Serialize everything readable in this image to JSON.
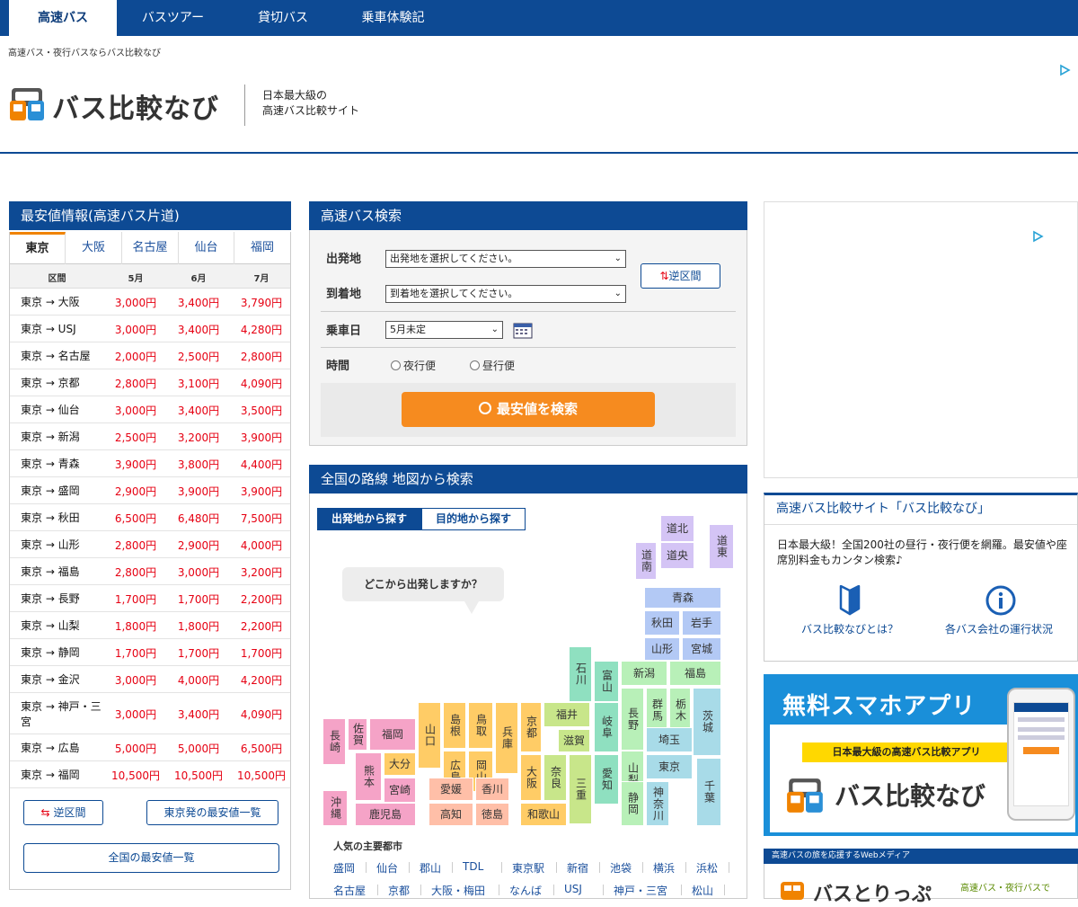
{
  "nav": {
    "tabs": [
      {
        "label": "高速バス"
      },
      {
        "label": "バスツアー"
      },
      {
        "label": "貸切バス"
      },
      {
        "label": "乗車体験記"
      }
    ]
  },
  "header": {
    "tagline": "高速バス・夜行バスならバス比較なび",
    "logo_text": "バス比較なび",
    "sub_line1": "日本最大級の",
    "sub_line2": "高速バス比較サイト"
  },
  "cheapest": {
    "title": "最安値情報(高速バス片道)",
    "tabs": [
      "東京",
      "大阪",
      "名古屋",
      "仙台",
      "福岡"
    ],
    "columns": [
      "区間",
      "5月",
      "6月",
      "7月"
    ],
    "rows": [
      {
        "route": "東京 → 大阪",
        "m5": "3,000円",
        "m6": "3,400円",
        "m7": "3,790円"
      },
      {
        "route": "東京 → USJ",
        "m5": "3,000円",
        "m6": "3,400円",
        "m7": "4,280円"
      },
      {
        "route": "東京 → 名古屋",
        "m5": "2,000円",
        "m6": "2,500円",
        "m7": "2,800円"
      },
      {
        "route": "東京 → 京都",
        "m5": "2,800円",
        "m6": "3,100円",
        "m7": "4,090円"
      },
      {
        "route": "東京 → 仙台",
        "m5": "3,000円",
        "m6": "3,400円",
        "m7": "3,500円"
      },
      {
        "route": "東京 → 新潟",
        "m5": "2,500円",
        "m6": "3,200円",
        "m7": "3,900円"
      },
      {
        "route": "東京 → 青森",
        "m5": "3,900円",
        "m6": "3,800円",
        "m7": "4,400円"
      },
      {
        "route": "東京 → 盛岡",
        "m5": "2,900円",
        "m6": "3,900円",
        "m7": "3,900円"
      },
      {
        "route": "東京 → 秋田",
        "m5": "6,500円",
        "m6": "6,480円",
        "m7": "7,500円"
      },
      {
        "route": "東京 → 山形",
        "m5": "2,800円",
        "m6": "2,900円",
        "m7": "4,000円"
      },
      {
        "route": "東京 → 福島",
        "m5": "2,800円",
        "m6": "3,000円",
        "m7": "3,200円"
      },
      {
        "route": "東京 → 長野",
        "m5": "1,700円",
        "m6": "1,700円",
        "m7": "2,200円"
      },
      {
        "route": "東京 → 山梨",
        "m5": "1,800円",
        "m6": "1,800円",
        "m7": "2,200円"
      },
      {
        "route": "東京 → 静岡",
        "m5": "1,700円",
        "m6": "1,700円",
        "m7": "1,700円"
      },
      {
        "route": "東京 → 金沢",
        "m5": "3,000円",
        "m6": "4,000円",
        "m7": "4,200円"
      },
      {
        "route": "東京 → 神戸・三宮",
        "m5": "3,000円",
        "m6": "3,400円",
        "m7": "4,090円"
      },
      {
        "route": "東京 → 広島",
        "m5": "5,000円",
        "m6": "5,000円",
        "m7": "6,500円"
      },
      {
        "route": "東京 → 福岡",
        "m5": "10,500円",
        "m6": "10,500円",
        "m7": "10,500円"
      }
    ],
    "reverse_label": "逆区間",
    "list_label": "東京発の最安値一覧",
    "all_label": "全国の最安値一覧"
  },
  "search": {
    "title": "高速バス検索",
    "from_label": "出発地",
    "from_value": "出発地を選択してください。",
    "to_label": "到着地",
    "to_value": "到着地を選択してください。",
    "date_label": "乗車日",
    "date_value": "5月未定",
    "time_label": "時間",
    "night_label": "夜行便",
    "day_label": "昼行便",
    "reverse_label": "逆区間",
    "submit_label": "最安値を検索"
  },
  "map": {
    "title": "全国の路線 地図から検索",
    "tab_from": "出発地から探す",
    "tab_to": "目的地から探す",
    "bubble": "どこから出発しますか？",
    "popular_title": "人気の主要都市",
    "cities_row1": [
      "盛岡",
      "仙台",
      "郡山",
      "TDL",
      "東京駅",
      "新宿",
      "池袋",
      "横浜",
      "浜松"
    ],
    "cities_row2": [
      "名古屋",
      "京都",
      "大阪・梅田",
      "なんば",
      "USJ",
      "神戸・三宮",
      "松山"
    ],
    "prefs": {
      "dohoku": "道北",
      "donan": "道南",
      "doou": "道央",
      "dotou": "道東",
      "aomori": "青森",
      "akita": "秋田",
      "iwate": "岩手",
      "yamagata": "山形",
      "miyagi": "宮城",
      "niigata": "新潟",
      "fukushima": "福島",
      "ishikawa": "石川",
      "toyama": "富山",
      "fukui": "福井",
      "gifu": "岐阜",
      "nagano": "長野",
      "gunma": "群馬",
      "tochigi": "栃木",
      "ibaraki": "茨城",
      "shiga": "滋賀",
      "saitama": "埼玉",
      "yamanashi": "山梨",
      "tokyo": "東京",
      "chiba": "千葉",
      "kyoto": "京都",
      "hyogo": "兵庫",
      "osaka": "大阪",
      "nara": "奈良",
      "mie": "三重",
      "aichi": "愛知",
      "shizuoka": "静岡",
      "kanagawa": "神奈川",
      "wakayama": "和歌山",
      "shimane": "島根",
      "tottori": "鳥取",
      "yamaguchi": "山口",
      "hiroshima": "広島",
      "okayama": "岡山",
      "ehime": "愛媛",
      "kagawa": "香川",
      "kochi": "高知",
      "tokushima": "徳島",
      "nagasaki": "長崎",
      "saga": "佐賀",
      "fukuoka": "福岡",
      "oita": "大分",
      "kumamoto": "熊本",
      "miyazaki": "宮崎",
      "okinawa": "沖縄",
      "kagoshima": "鹿児島"
    }
  },
  "about": {
    "title": "高速バス比較サイト「バス比較なび」",
    "text": "日本最大級！全国200社の昼行・夜行便を網羅。最安値や座席別料金もカンタン検索♪",
    "link1": "バス比較なびとは？",
    "link2": "各バス会社の運行状況"
  },
  "app": {
    "title": "無料スマホアプリ",
    "banner": "日本最大級の高速バス比較アプリ",
    "logo_text": "バス比較なび"
  },
  "media": {
    "bar": "高速バスの旅を応援するWebメディア",
    "logo_text": "バスとりっぷ",
    "sub": "高速バス・夜行バスで"
  },
  "colors": {
    "brand": "#0d4a94",
    "accent": "#f68b1f",
    "price": "#e60012"
  }
}
